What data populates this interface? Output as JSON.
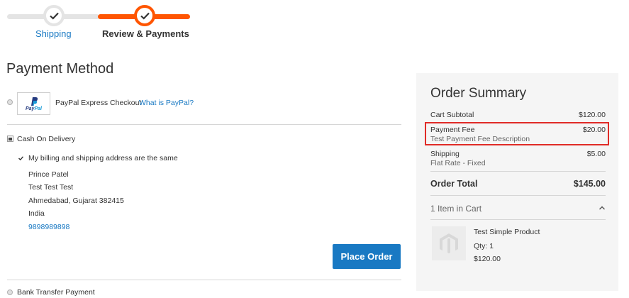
{
  "progress": {
    "steps": [
      {
        "label": "Shipping",
        "state": "complete"
      },
      {
        "label": "Review & Payments",
        "state": "active"
      }
    ]
  },
  "payment_method": {
    "title": "Payment Method",
    "paypal": {
      "label": "PayPal Express Checkout",
      "link": "What is PayPal?",
      "logo_text_1": "Pay",
      "logo_text_2": "Pal"
    },
    "cod": {
      "label": "Cash On Delivery",
      "same_address_label": "My billing and shipping address are the same",
      "address_lines": [
        "Prince Patel",
        "Test Test Test",
        "Ahmedabad, Gujarat 382415",
        "India"
      ],
      "phone": "9898989898",
      "place_order": "Place Order"
    },
    "bank_transfer": {
      "label": "Bank Transfer Payment"
    }
  },
  "summary": {
    "title": "Order Summary",
    "cart_subtotal": {
      "label": "Cart Subtotal",
      "value": "$120.00"
    },
    "payment_fee": {
      "label": "Payment Fee",
      "value": "$20.00",
      "description": "Test Payment Fee Description"
    },
    "shipping": {
      "label": "Shipping",
      "value": "$5.00",
      "method": "Flat Rate - Fixed"
    },
    "order_total": {
      "label": "Order Total",
      "value": "$145.00"
    },
    "items_in_cart": "1 Item in Cart",
    "product": {
      "name": "Test Simple Product",
      "qty": "Qty: 1",
      "price": "$120.00"
    }
  },
  "colors": {
    "accent": "#ff5501",
    "primary": "#1979c3",
    "highlight": "#e02b27"
  }
}
